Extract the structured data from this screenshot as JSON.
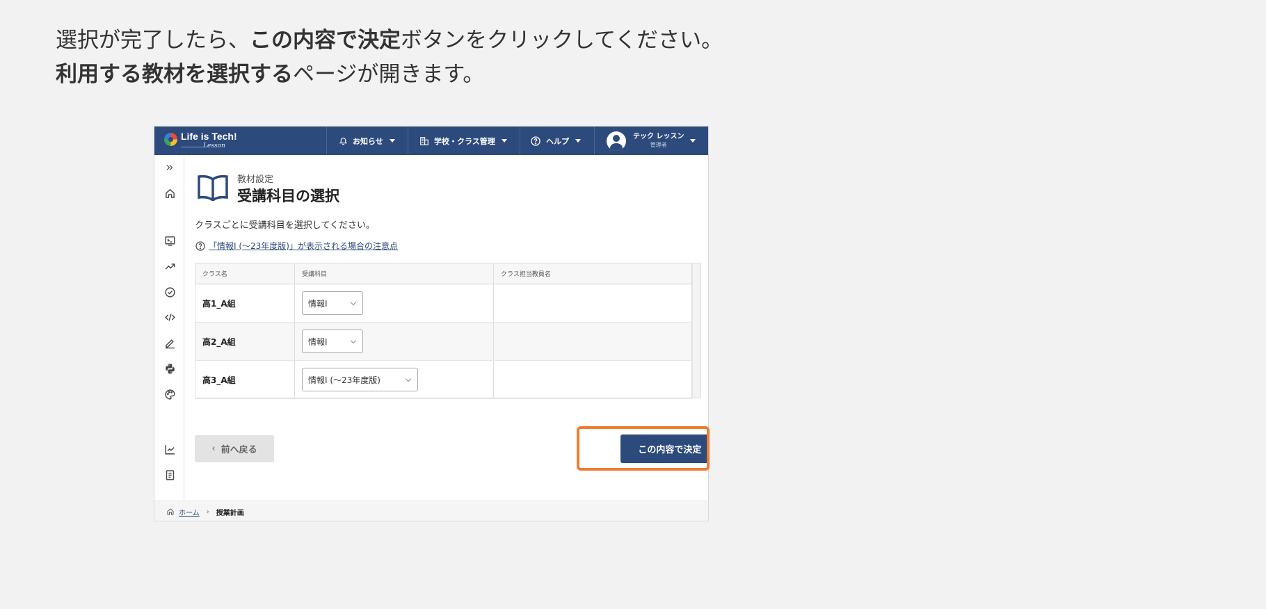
{
  "instruction": {
    "line1_pre": "選択が完了したら、",
    "line1_bold": "この内容で決定",
    "line1_post": "ボタンをクリックしてください。",
    "line2_bold": "利用する教材を選択する",
    "line2_post": "ページが開きます。"
  },
  "app": {
    "brand": "Life is Tech!",
    "brand_sub": "Lesson",
    "nav": {
      "notifications": "お知らせ",
      "school_class": "学校・クラス管理",
      "help": "ヘルプ",
      "user_name": "テック レッスン",
      "user_role": "管理者"
    }
  },
  "sidebar": {
    "items": [
      "expand-icon",
      "home-icon",
      "terminal-icon",
      "trend-icon",
      "check-circle-icon",
      "code-icon",
      "pencil-icon",
      "python-icon",
      "palette-icon",
      "chart-icon",
      "document-icon"
    ]
  },
  "page": {
    "subtitle": "教材設定",
    "title": "受講科目の選択",
    "description": "クラスごとに受講科目を選択してください。",
    "note_link": "「情報I (〜23年度版)」が表示される場合の注意点"
  },
  "table": {
    "headers": [
      "クラス名",
      "受講科目",
      "クラス担当教員名"
    ],
    "rows": [
      {
        "class_name": "高1_A組",
        "subject": "情報I",
        "teacher": ""
      },
      {
        "class_name": "高2_A組",
        "subject": "情報I",
        "teacher": ""
      },
      {
        "class_name": "高3_A組",
        "subject": "情報I (〜23年度版)",
        "teacher": ""
      }
    ]
  },
  "buttons": {
    "back": "前へ戻る",
    "confirm": "この内容で決定"
  },
  "breadcrumb": {
    "home": "ホーム",
    "current": "授業計画"
  },
  "colors": {
    "header": "#2c4a7c",
    "highlight": "#ee7d31",
    "chat": "#3a78c9"
  }
}
